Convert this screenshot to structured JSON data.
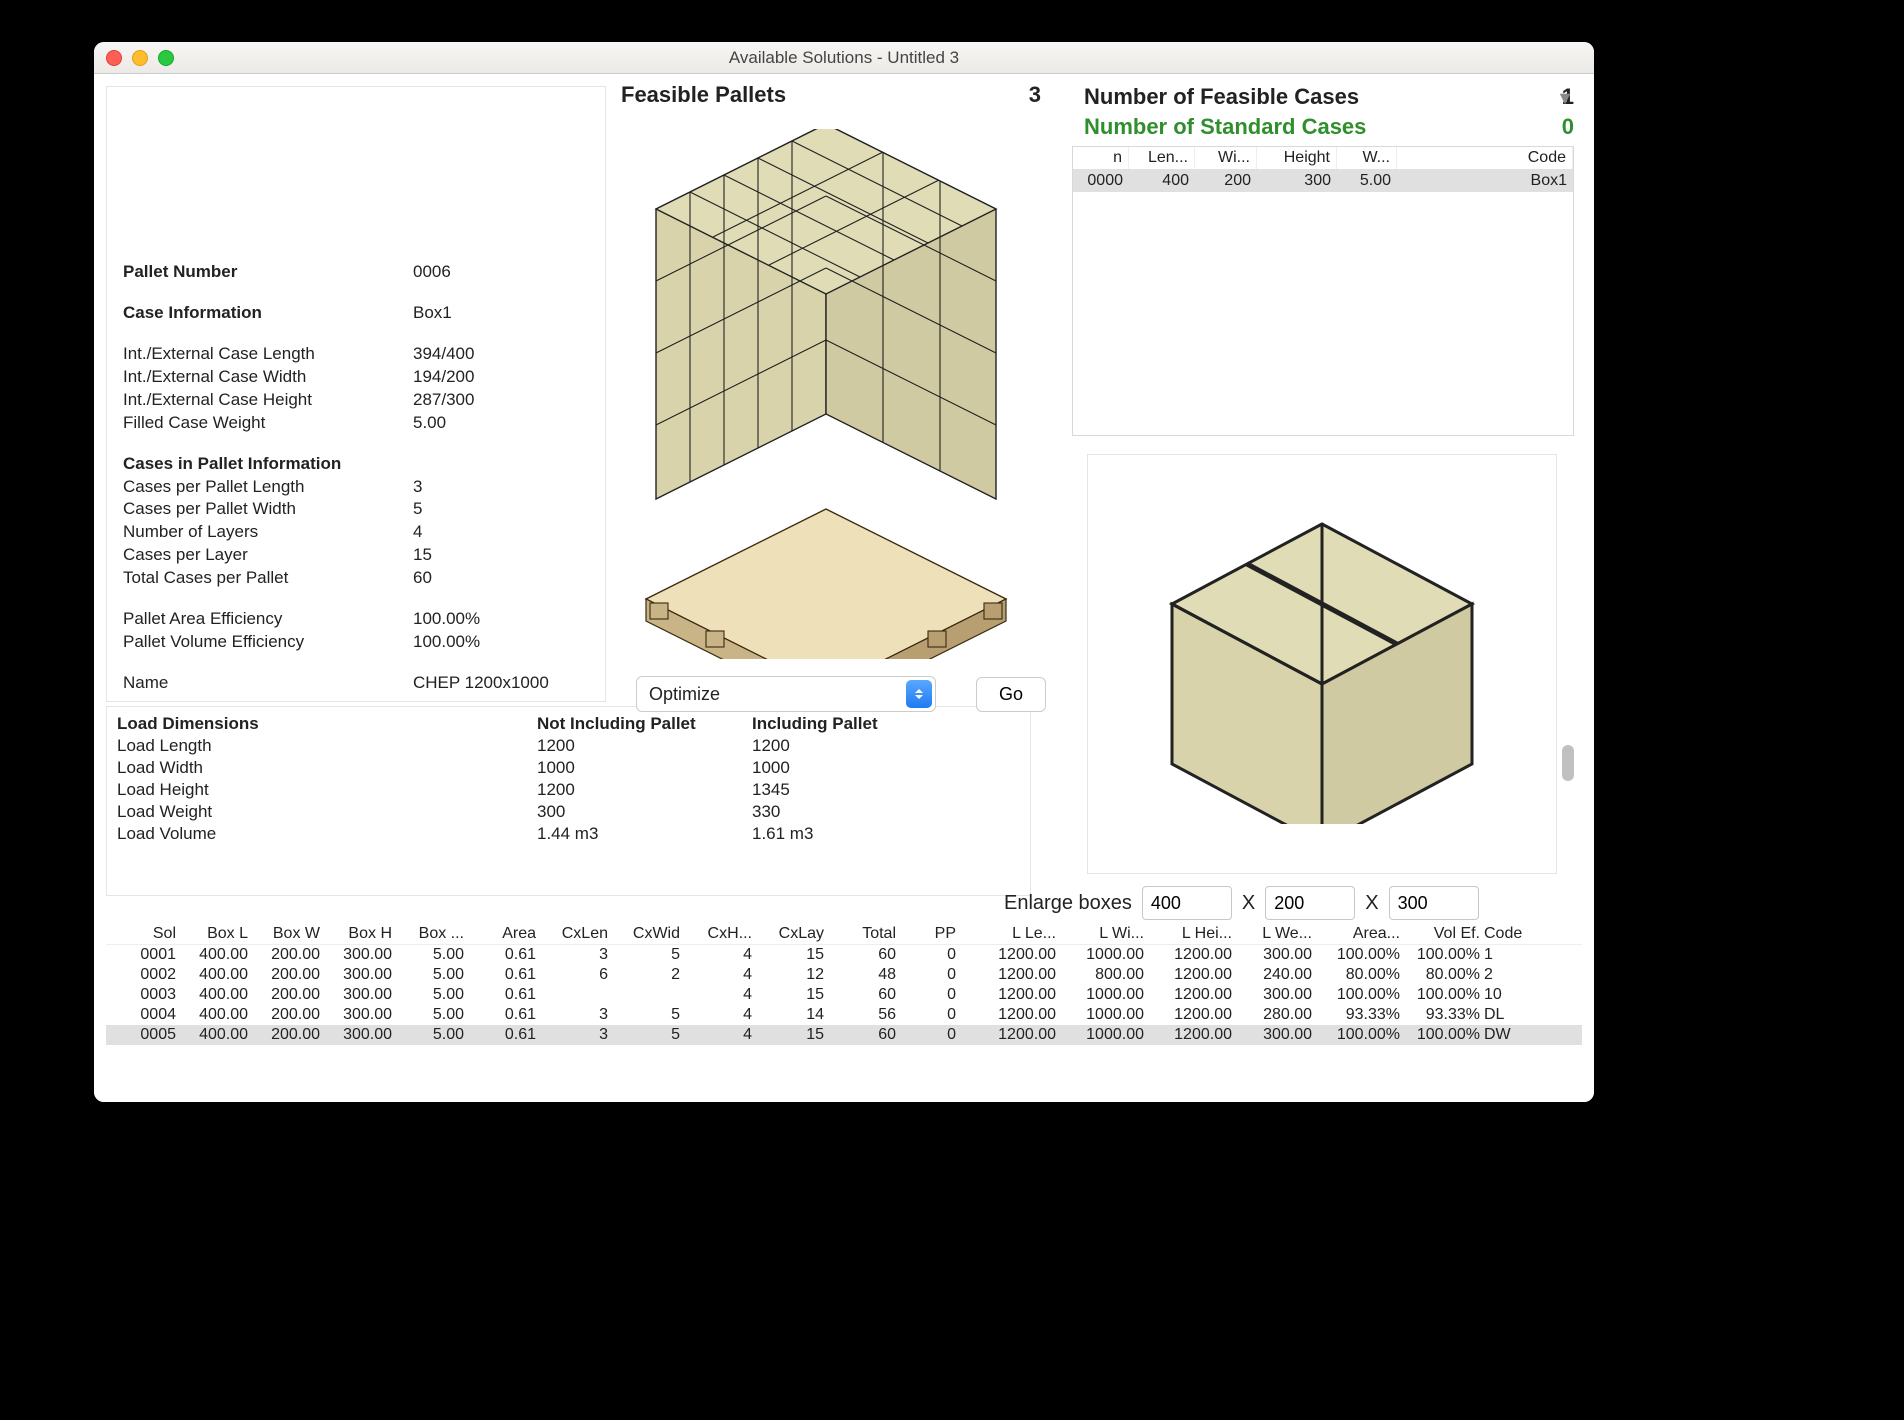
{
  "window": {
    "title": "Available Solutions - Untitled 3"
  },
  "info": {
    "pallet_number_label": "Pallet Number",
    "pallet_number_value": "0006",
    "case_info_label": "Case Information",
    "case_info_value": "Box1",
    "lines": [
      {
        "label": "Int./External Case Length",
        "value": "394/400"
      },
      {
        "label": "Int./External Case Width",
        "value": "194/200"
      },
      {
        "label": "Int./External Case Height",
        "value": "287/300"
      },
      {
        "label": "Filled Case Weight",
        "value": "5.00"
      }
    ],
    "cases_header": "Cases in Pallet Information",
    "cases_lines": [
      {
        "label": "Cases per Pallet Length",
        "value": "3"
      },
      {
        "label": "Cases per Pallet Width",
        "value": "5"
      },
      {
        "label": "Number of Layers",
        "value": "4"
      },
      {
        "label": "Cases per Layer",
        "value": "15"
      },
      {
        "label": "Total Cases per Pallet",
        "value": "60"
      }
    ],
    "eff_lines": [
      {
        "label": "Pallet Area Efficiency",
        "value": "100.00%"
      },
      {
        "label": "Pallet Volume Efficiency",
        "value": "100.00%"
      }
    ],
    "name_label": "Name",
    "name_value": "CHEP 1200x1000"
  },
  "load": {
    "header": "Load Dimensions",
    "col_not": "Not Including Pallet",
    "col_inc": "Including Pallet",
    "rows": [
      {
        "label": "Load Length",
        "not": "1200",
        "inc": "1200"
      },
      {
        "label": "Load Width",
        "not": "1000",
        "inc": "1000"
      },
      {
        "label": "Load Height",
        "not": "1200",
        "inc": "1345"
      },
      {
        "label": "Load Weight",
        "not": "300",
        "inc": "330"
      },
      {
        "label": "Load Volume",
        "not": "1.44 m3",
        "inc": "1.61 m3"
      }
    ]
  },
  "pallets": {
    "title": "Feasible Pallets",
    "count": "3"
  },
  "optimize": {
    "label": "Optimize",
    "go": "Go"
  },
  "cases_header": {
    "feasible_label": "Number of Feasible Cases",
    "feasible_count": "1",
    "standard_label": "Number of Standard Cases",
    "standard_count": "0"
  },
  "cases_table": {
    "cols": [
      "n",
      "Len...",
      "Wi...",
      "Height",
      "W...",
      "Code"
    ],
    "row": [
      "0000",
      "400",
      "200",
      "300",
      "5.00",
      "Box1"
    ]
  },
  "enlarge": {
    "label": "Enlarge boxes",
    "x": "X",
    "v1": "400",
    "v2": "200",
    "v3": "300"
  },
  "solutions": {
    "cols": [
      "Sol",
      "Box L",
      "Box W",
      "Box H",
      "Box ...",
      "Area",
      "CxLen",
      "CxWid",
      "CxH...",
      "CxLay",
      "Total",
      "PP",
      "L Le...",
      "L Wi...",
      "L Hei...",
      "L We...",
      "Area...",
      "Vol Ef.",
      "Code"
    ],
    "rows": [
      [
        "0001",
        "400.00",
        "200.00",
        "300.00",
        "5.00",
        "0.61",
        "3",
        "5",
        "4",
        "15",
        "60",
        "0",
        "1200.00",
        "1000.00",
        "1200.00",
        "300.00",
        "100.00%",
        "100.00%",
        "1"
      ],
      [
        "0002",
        "400.00",
        "200.00",
        "300.00",
        "5.00",
        "0.61",
        "6",
        "2",
        "4",
        "12",
        "48",
        "0",
        "1200.00",
        "800.00",
        "1200.00",
        "240.00",
        "80.00%",
        "80.00%",
        "2"
      ],
      [
        "0003",
        "400.00",
        "200.00",
        "300.00",
        "5.00",
        "0.61",
        "",
        "",
        "4",
        "15",
        "60",
        "0",
        "1200.00",
        "1000.00",
        "1200.00",
        "300.00",
        "100.00%",
        "100.00%",
        "10"
      ],
      [
        "0004",
        "400.00",
        "200.00",
        "300.00",
        "5.00",
        "0.61",
        "3",
        "5",
        "4",
        "14",
        "56",
        "0",
        "1200.00",
        "1000.00",
        "1200.00",
        "280.00",
        "93.33%",
        "93.33%",
        "DL"
      ],
      [
        "0005",
        "400.00",
        "200.00",
        "300.00",
        "5.00",
        "0.61",
        "3",
        "5",
        "4",
        "15",
        "60",
        "0",
        "1200.00",
        "1000.00",
        "1200.00",
        "300.00",
        "100.00%",
        "100.00%",
        "DW"
      ]
    ],
    "selected_index": 4
  }
}
